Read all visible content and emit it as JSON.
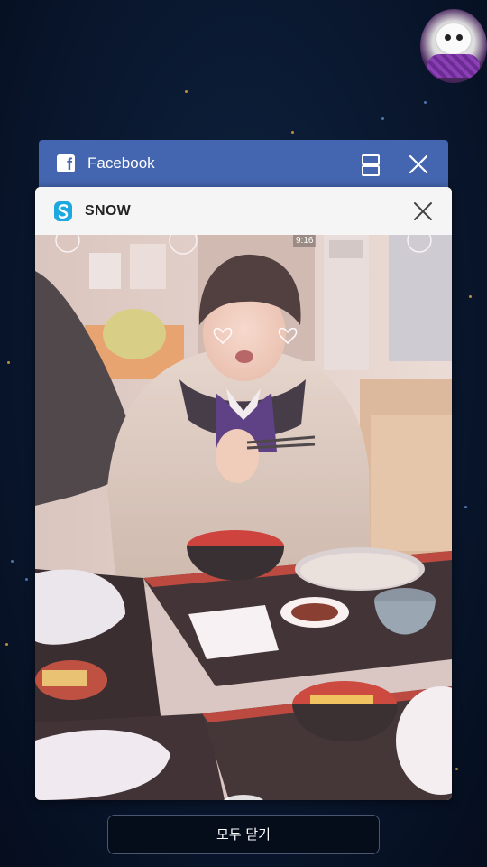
{
  "recent_apps": [
    {
      "title": "Facebook"
    },
    {
      "title": "SNOW"
    }
  ],
  "photo_overlay": {
    "camera_timer": "9:16"
  },
  "bottom": {
    "close_all_label": "모두 닫기"
  },
  "colors": {
    "facebook_header": "#4466b0",
    "background": "#0b1a33",
    "snow_logo": "#1ea8e0"
  }
}
